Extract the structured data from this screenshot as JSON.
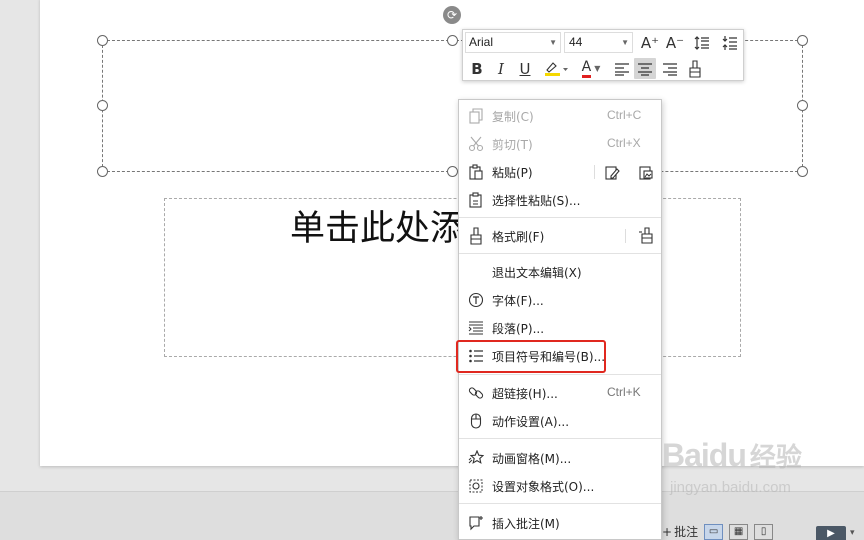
{
  "slide": {
    "subtitle_placeholder": "单击此处添"
  },
  "mini_toolbar": {
    "font_name": "Arial",
    "font_size": "44",
    "buttons": {
      "grow_font": "A⁺",
      "shrink_font": "A⁻",
      "bold": "B",
      "italic": "I",
      "underline": "U",
      "font_color": "A"
    },
    "colors": {
      "highlight": "#f5d800",
      "font_color": "#e02020"
    }
  },
  "context_menu": {
    "copy": {
      "label": "复制(C)",
      "shortcut": "Ctrl+C"
    },
    "cut": {
      "label": "剪切(T)",
      "shortcut": "Ctrl+X"
    },
    "paste": {
      "label": "粘贴(P)"
    },
    "paste_special": {
      "label": "选择性粘贴(S)..."
    },
    "format_painter": {
      "label": "格式刷(F)"
    },
    "exit_text_edit": {
      "label": "退出文本编辑(X)"
    },
    "font": {
      "label": "字体(F)..."
    },
    "paragraph": {
      "label": "段落(P)..."
    },
    "bullets_numbering": {
      "label": "项目符号和编号(B)..."
    },
    "hyperlink": {
      "label": "超链接(H)...",
      "shortcut": "Ctrl+K"
    },
    "action_settings": {
      "label": "动作设置(A)..."
    },
    "animation_pane": {
      "label": "动画窗格(M)..."
    },
    "format_object": {
      "label": "设置对象格式(O)..."
    },
    "insert_comment": {
      "label": "插入批注(M)"
    }
  },
  "status_bar": {
    "comment_label": "批注"
  },
  "watermark": {
    "brand": "Baidu",
    "cn": "经验",
    "url": "jingyan.baidu.com"
  }
}
